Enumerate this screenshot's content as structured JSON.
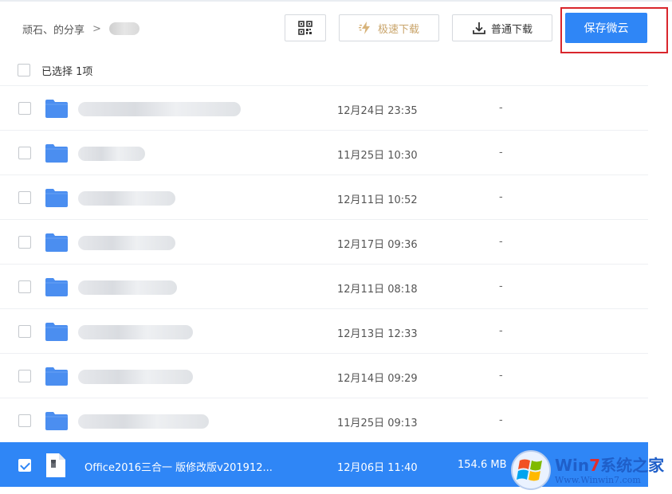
{
  "breadcrumb": {
    "root": "顽石、的分享",
    "separator": ">"
  },
  "toolbar": {
    "qr_icon": "qr-code-icon",
    "fast_download_label": "极速下载",
    "normal_download_label": "普通下载",
    "save_label": "保存微云"
  },
  "selection": {
    "text": "已选择 1项"
  },
  "files": [
    {
      "type": "folder",
      "date": "12月24日 23:35",
      "size": "-"
    },
    {
      "type": "folder",
      "date": "11月25日 10:30",
      "size": "-"
    },
    {
      "type": "folder",
      "date": "12月11日 10:52",
      "size": "-"
    },
    {
      "type": "folder",
      "date": "12月17日 09:36",
      "size": "-"
    },
    {
      "type": "folder",
      "date": "12月11日 08:18",
      "size": "-"
    },
    {
      "type": "folder",
      "date": "12月13日 12:33",
      "size": "-"
    },
    {
      "type": "folder",
      "date": "12月14日 09:29",
      "size": "-"
    },
    {
      "type": "folder",
      "date": "11月25日 09:13",
      "size": "-"
    },
    {
      "type": "file",
      "name": "Office2016三合一 版修改版v201912...",
      "date": "12月06日 11:40",
      "size": "154.6 MB",
      "selected": true
    }
  ],
  "watermark": {
    "title_prefix": "Win",
    "title_seven": "7",
    "title_suffix": "系统之家",
    "url": "Www.Winwin7.com"
  },
  "colors": {
    "accent": "#2f86f6",
    "highlight_box": "#d9262c",
    "folder": "#4b8ef0"
  }
}
